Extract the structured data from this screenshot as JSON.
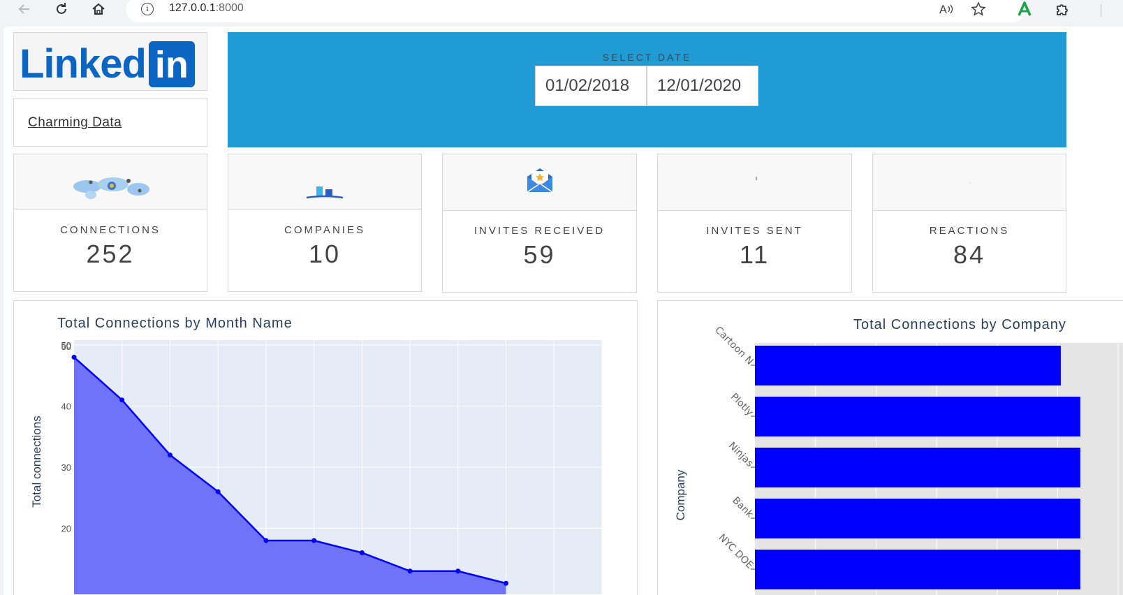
{
  "browser": {
    "url_host": "127.0.0.1",
    "url_port": ":8000"
  },
  "brand": {
    "logo_text": "Linked",
    "logo_in": "in",
    "link_label": "Charming Data"
  },
  "date_picker": {
    "label": "SELECT DATE",
    "start_date": "01/02/2018",
    "end_date": "12/01/2020",
    "panel_color": "#219bd3"
  },
  "kpis": [
    {
      "label": "CONNECTIONS",
      "value": "252",
      "icon": "world-map-icon"
    },
    {
      "label": "COMPANIES",
      "value": "10",
      "icon": "building-chart-icon"
    },
    {
      "label": "INVITES RECEIVED",
      "value": "59",
      "icon": "envelope-star-icon"
    },
    {
      "label": "INVITES SENT",
      "value": "11",
      "icon": "invite-sent-icon"
    },
    {
      "label": "REACTIONS",
      "value": "84",
      "icon": "reactions-icon"
    }
  ],
  "chart_data": [
    {
      "type": "area",
      "title": "Total Connections by Month Name",
      "xlabel": "",
      "ylabel": "Total connections",
      "y_ticks": [
        20,
        30,
        40,
        50
      ],
      "values": [
        48,
        41,
        32,
        26,
        18,
        18,
        16,
        13,
        13,
        11
      ],
      "color": "#0000ff",
      "fill_color": "#6f73f7",
      "plot_bg": "#e5ecf6",
      "grid": true
    },
    {
      "type": "bar",
      "orientation": "horizontal",
      "title": "Total Connections by Company",
      "ylabel": "Company",
      "categories": [
        "Cartoon N",
        "Plotly",
        "Ninjas",
        "Bank",
        "NYC DOE"
      ],
      "values": [
        0.94,
        1.0,
        1.0,
        1.0,
        1.0
      ],
      "color": "#0000ff",
      "plot_bg": "#e5e5e5",
      "grid": true
    }
  ]
}
